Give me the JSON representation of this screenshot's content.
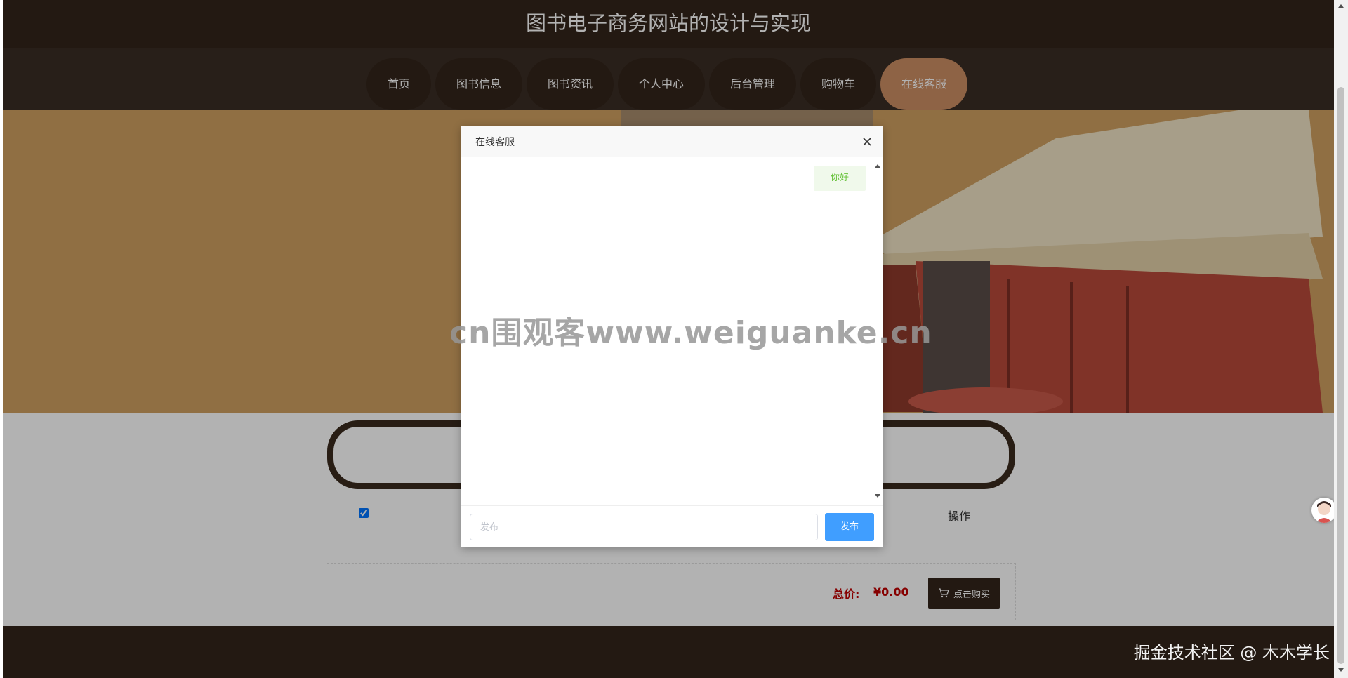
{
  "site": {
    "title": "图书电子商务网站的设计与实现"
  },
  "nav": {
    "items": [
      {
        "label": "首页"
      },
      {
        "label": "图书信息"
      },
      {
        "label": "图书资讯"
      },
      {
        "label": "个人中心"
      },
      {
        "label": "后台管理"
      },
      {
        "label": "购物车"
      },
      {
        "label": "在线客服",
        "active": true
      }
    ]
  },
  "cart": {
    "operation_header": "操作",
    "total_label": "总价:",
    "total_value": "¥0.00",
    "buy_label": "点击购买",
    "buy_icon": "cart-icon"
  },
  "dialog": {
    "title": "在线客服",
    "close_icon": "close-icon",
    "messages": [
      {
        "text": "你好",
        "side": "right"
      }
    ],
    "input_placeholder": "发布",
    "send_label": "发布"
  },
  "watermark": "cn围观客www.weiguanke.cn",
  "credit": "掘金技术社区 @ 木木学长",
  "colors": {
    "header": "#33251b",
    "nav_active": "#cc8e63",
    "total": "#c00000",
    "send": "#409eff",
    "bubble_bg": "#f0f9eb",
    "bubble_text": "#67c23a"
  }
}
